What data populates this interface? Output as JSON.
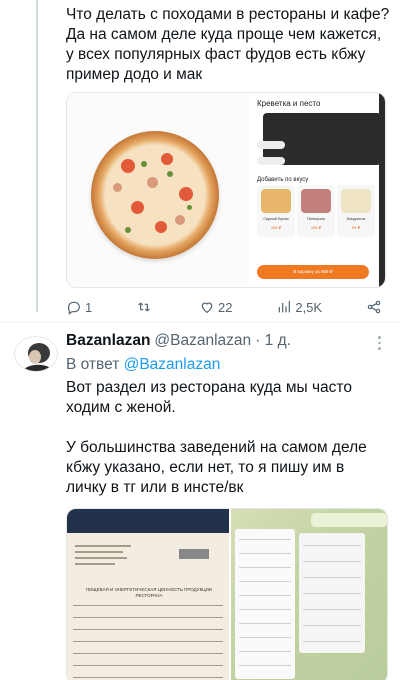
{
  "tweet1": {
    "text": "Что делать с походами в рестораны и кафе?\nДа на самом деле куда проще чем кажется,\nу всех популярных фаст фудов есть кбжу\nпример додо и мак",
    "media": {
      "product_title": "Креветка и песто",
      "recommendations_title": "Добавить по вкусу",
      "items": [
        {
          "name": "Сырный бортик",
          "price": "159 ₽"
        },
        {
          "name": "Пепперони",
          "price": "139 ₽"
        },
        {
          "name": "Моцарелла",
          "price": "99 ₽"
        }
      ],
      "cart_button": "В корзину за 959 ₽"
    },
    "actions": {
      "replies": "1",
      "retweets": "",
      "likes": "22",
      "views": "2,5K"
    }
  },
  "tweet2": {
    "name": "Bazanlazan",
    "handle": "@Bazanlazan",
    "time": "· 1 д.",
    "reply_prefix": "В ответ",
    "reply_handle": "@Bazanlazan",
    "text": "Вот раздел из ресторана куда мы часто\nходим с женой.\n\nУ большинства заведений на самом деле\nкбжу указано, если нет, то я пишу им в\nличку в тг или в инсте/вк",
    "doc": {
      "title": "ПИЩЕВАЯ И ЭНЕРГЕТИЧЕСКАЯ ЦЕННОСТЬ ПРОДУКЦИИ РЕСТОРАНА"
    }
  },
  "colors": {
    "accent": "#1d9bf0",
    "muted": "#536471",
    "orange": "#f07a22"
  }
}
